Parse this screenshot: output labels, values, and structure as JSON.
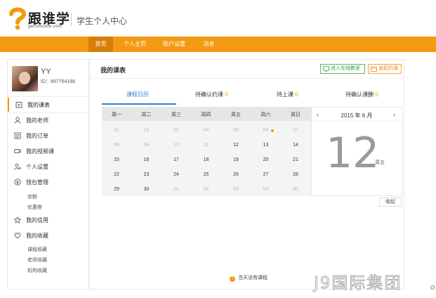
{
  "header": {
    "logo_text": "跟谁学",
    "logo_sub": "genshuixue.com",
    "site_title": "学生个人中心"
  },
  "nav": {
    "items": [
      {
        "label": "首页",
        "active": true
      },
      {
        "label": "个人主页",
        "active": false
      },
      {
        "label": "账户设置",
        "active": false
      },
      {
        "label": "消息",
        "active": false
      }
    ]
  },
  "user": {
    "name": "YY",
    "id": "ID：897764168"
  },
  "sidebar": {
    "items": [
      {
        "label": "我的课表",
        "icon": "schedule-icon",
        "active": true
      },
      {
        "label": "我的老师",
        "icon": "person-icon"
      },
      {
        "label": "我的订单",
        "icon": "list-icon"
      },
      {
        "label": "我的视频课",
        "icon": "video-icon"
      },
      {
        "label": "个人设置",
        "icon": "user-settings-icon"
      },
      {
        "label": "钱包管理",
        "icon": "yen-icon"
      },
      {
        "label": "我的信用",
        "icon": "star-icon"
      },
      {
        "label": "我的收藏",
        "icon": "heart-icon"
      }
    ],
    "wallet_sub": [
      "余额",
      "优惠券"
    ],
    "favorites_sub": [
      "课程收藏",
      "老师收藏",
      "机构收藏"
    ]
  },
  "main": {
    "title": "我的课表",
    "btn_online": "进入在线教室",
    "btn_invite": "发起约课",
    "tabs": [
      {
        "label": "课程日历",
        "count": "",
        "active": true
      },
      {
        "label": "待确认约课",
        "count": "0"
      },
      {
        "label": "待上课",
        "count": "0"
      },
      {
        "label": "待确认课酬",
        "count": "0"
      }
    ],
    "empty_note": "当天没有课程",
    "collapse_label": "收起"
  },
  "calendar": {
    "weekdays": [
      "周一",
      "周二",
      "周三",
      "周四",
      "周五",
      "周六",
      "周日"
    ],
    "rows": [
      [
        "01",
        "02",
        "03",
        "04",
        "05",
        "06",
        "07"
      ],
      [
        "08",
        "09",
        "10",
        "11",
        "12",
        "13",
        "14"
      ],
      [
        "15",
        "16",
        "17",
        "18",
        "19",
        "20",
        "21"
      ],
      [
        "22",
        "23",
        "24",
        "25",
        "26",
        "27",
        "28"
      ],
      [
        "29",
        "30",
        "01",
        "02",
        "03",
        "04",
        "05"
      ]
    ],
    "muted": [
      [
        true,
        true,
        true,
        true,
        true,
        true,
        true
      ],
      [
        true,
        true,
        true,
        true,
        false,
        false,
        false
      ],
      [
        false,
        false,
        false,
        false,
        false,
        false,
        false
      ],
      [
        false,
        false,
        false,
        false,
        false,
        false,
        false
      ],
      [
        false,
        false,
        true,
        true,
        true,
        true,
        true
      ]
    ],
    "dot_cell": [
      0,
      5
    ],
    "month_label": "2015 年 6 月",
    "prev": "‹",
    "next": "›",
    "selected_day": "12",
    "selected_weekday": "周五"
  },
  "watermark": "J9国际集团",
  "corner_glyph": "ʘ"
}
